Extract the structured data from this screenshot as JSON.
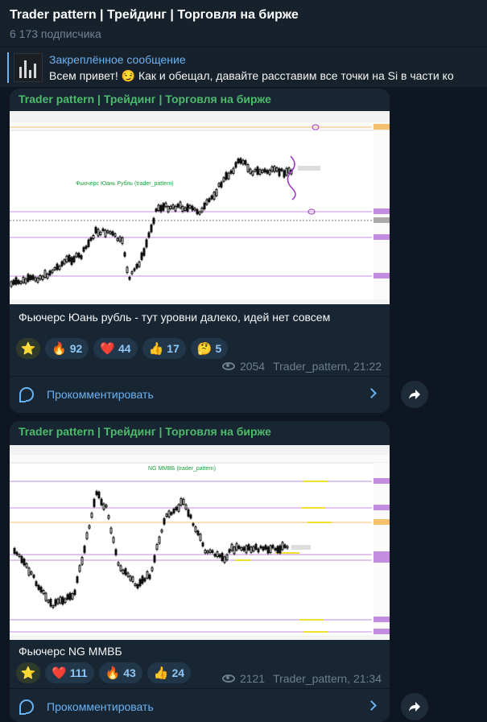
{
  "channel": {
    "title": "Trader pattern | Трейдинг | Торговля на бирже",
    "subscribers": "6 173 подписчика"
  },
  "pinned": {
    "title": "Закреплённое сообщение",
    "text": "Всем привет! 😏 Как и обещал, давайте расставим все точки на Si в части ко"
  },
  "posts": [
    {
      "author": "Trader pattern | Трейдинг | Торговля на бирже",
      "chart_label": "Фьючерс Юань Рубль (trader_pattern)",
      "caption": "Фьючерс Юань рубль - тут уровни далеко, идей нет совсем",
      "reactions": [
        {
          "emoji": "⭐",
          "count": ""
        },
        {
          "emoji": "🔥",
          "count": "92"
        },
        {
          "emoji": "❤️",
          "count": "44"
        },
        {
          "emoji": "👍",
          "count": "17"
        },
        {
          "emoji": "🤔",
          "count": "5"
        }
      ],
      "views": "2054",
      "signature": "Trader_pattern, 21:22",
      "comment_label": "Прокомментировать"
    },
    {
      "author": "Trader pattern | Трейдинг | Торговля на бирже",
      "chart_label": "NG MMBБ (trader_pattern)",
      "caption": "Фьючерс NG ММВБ",
      "reactions": [
        {
          "emoji": "⭐",
          "count": ""
        },
        {
          "emoji": "❤️",
          "count": "111"
        },
        {
          "emoji": "🔥",
          "count": "43"
        },
        {
          "emoji": "👍",
          "count": "24"
        }
      ],
      "views": "2121",
      "signature": "Trader_pattern, 21:34",
      "comment_label": "Прокомментировать"
    }
  ],
  "colors": {
    "background": "#0e1621",
    "card": "#182533",
    "accent": "#6ab2f2",
    "author": "#4cbb6a"
  },
  "icons": [
    "eye-icon",
    "comment-icon",
    "chevron-right-icon",
    "share-icon"
  ]
}
